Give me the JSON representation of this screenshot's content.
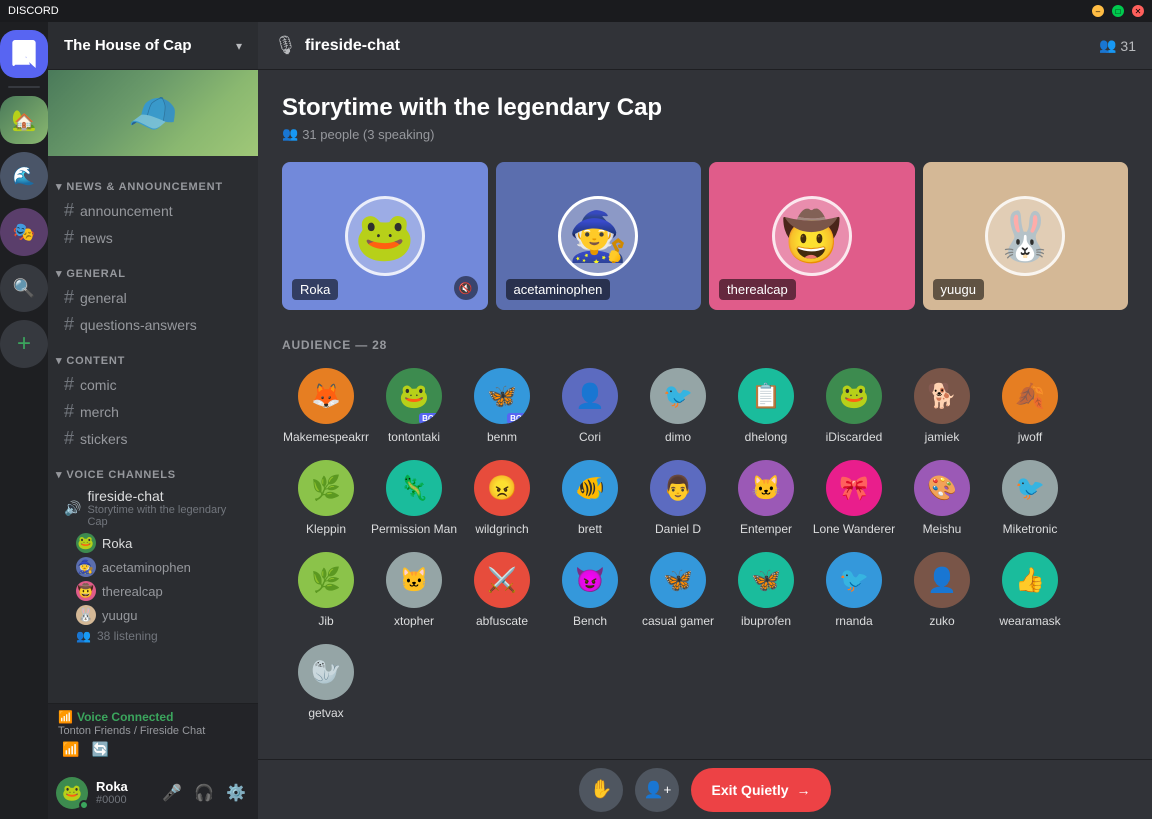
{
  "app": {
    "title": "DISCORD",
    "window_controls": {
      "minimize": "–",
      "maximize": "□",
      "close": "✕"
    }
  },
  "server": {
    "name": "The House of Cap",
    "checked": true
  },
  "channel_header": {
    "channel_name": "fireside-chat",
    "member_count": "31",
    "members_icon": "👥"
  },
  "stage": {
    "title": "Storytime with the legendary Cap",
    "meta": "31 people (3 speaking)"
  },
  "speakers": [
    {
      "name": "Roka",
      "color": "card-blue",
      "avatar_emoji": "🐸",
      "has_mute": true
    },
    {
      "name": "acetaminophen",
      "color": "card-purple",
      "avatar_emoji": "🧙",
      "has_mute": false
    },
    {
      "name": "therealcap",
      "color": "card-pink",
      "avatar_emoji": "🤠",
      "has_mute": false
    },
    {
      "name": "yuugu",
      "color": "card-tan",
      "avatar_emoji": "🐰",
      "has_mute": false
    }
  ],
  "audience_header": "AUDIENCE — 28",
  "audience_members": [
    {
      "name": "Makemespeakrr",
      "emoji": "🦊",
      "av_class": "av-orange"
    },
    {
      "name": "tontontaki",
      "emoji": "🐸",
      "av_class": "av-green",
      "bot": true
    },
    {
      "name": "benm",
      "emoji": "🦋",
      "av_class": "av-blue",
      "bot": true
    },
    {
      "name": "Cori",
      "emoji": "👤",
      "av_class": "av-indigo"
    },
    {
      "name": "dimo",
      "emoji": "🐦",
      "av_class": "av-gray"
    },
    {
      "name": "dhelong",
      "emoji": "📋",
      "av_class": "av-teal"
    },
    {
      "name": "iDiscarded",
      "emoji": "🐸",
      "av_class": "av-green"
    },
    {
      "name": "jamiek",
      "emoji": "🐕",
      "av_class": "av-brown"
    },
    {
      "name": "jwoff",
      "emoji": "🍂",
      "av_class": "av-orange"
    },
    {
      "name": "Kleppin",
      "emoji": "🌿",
      "av_class": "av-lime"
    },
    {
      "name": "Permission Man",
      "emoji": "🦎",
      "av_class": "av-teal"
    },
    {
      "name": "wildgrinch",
      "emoji": "😠",
      "av_class": "av-red"
    },
    {
      "name": "brett",
      "emoji": "🐠",
      "av_class": "av-blue"
    },
    {
      "name": "Daniel D",
      "emoji": "👨",
      "av_class": "av-indigo"
    },
    {
      "name": "Entemper",
      "emoji": "🐱",
      "av_class": "av-purple"
    },
    {
      "name": "Lone Wanderer",
      "emoji": "🎀",
      "av_class": "av-pink"
    },
    {
      "name": "Meishu",
      "emoji": "🎨",
      "av_class": "av-purple"
    },
    {
      "name": "Miketronic",
      "emoji": "🐦",
      "av_class": "av-gray"
    },
    {
      "name": "Jib",
      "emoji": "🌿",
      "av_class": "av-lime"
    },
    {
      "name": "xtopher",
      "emoji": "🐱",
      "av_class": "av-gray"
    },
    {
      "name": "abfuscate",
      "emoji": "⚔️",
      "av_class": "av-red"
    },
    {
      "name": "Bench",
      "emoji": "😈",
      "av_class": "av-blue"
    },
    {
      "name": "casual gamer",
      "emoji": "🦋",
      "av_class": "av-blue"
    },
    {
      "name": "ibuprofen",
      "emoji": "🦋",
      "av_class": "av-teal"
    },
    {
      "name": "rnanda",
      "emoji": "🐦",
      "av_class": "av-blue"
    },
    {
      "name": "zuko",
      "emoji": "👤",
      "av_class": "av-brown"
    },
    {
      "name": "wearamask",
      "emoji": "👍",
      "av_class": "av-teal"
    },
    {
      "name": "getvax",
      "emoji": "🦭",
      "av_class": "av-gray"
    }
  ],
  "sidebar": {
    "sections": [
      {
        "name": "NEWS & ANNOUNCEMENT",
        "channels": [
          {
            "name": "announcement",
            "type": "text"
          },
          {
            "name": "news",
            "type": "text"
          }
        ]
      },
      {
        "name": "GENERAL",
        "channels": [
          {
            "name": "general",
            "type": "text"
          },
          {
            "name": "questions-answers",
            "type": "text"
          }
        ]
      },
      {
        "name": "CONTENT",
        "channels": [
          {
            "name": "comic",
            "type": "text"
          },
          {
            "name": "merch",
            "type": "text"
          },
          {
            "name": "stickers",
            "type": "text"
          }
        ]
      }
    ],
    "voice_section": "VOICE CHANNELS",
    "voice_channel": "fireside-chat",
    "voice_channel_sub": "Storytime with the legendary Cap",
    "voice_members": [
      "Roka",
      "acetaminophen",
      "therealcap",
      "yuugu"
    ],
    "listening_count": "38 listening"
  },
  "voice_connected": {
    "status": "Voice Connected",
    "channel": "Tonton Friends / Fireside Chat"
  },
  "user": {
    "name": "Roka",
    "tag": "#0000"
  },
  "action_bar": {
    "raise_hand_label": "✋",
    "add_speaker_label": "👤+",
    "exit_label": "Exit Quietly",
    "exit_icon": "→"
  }
}
